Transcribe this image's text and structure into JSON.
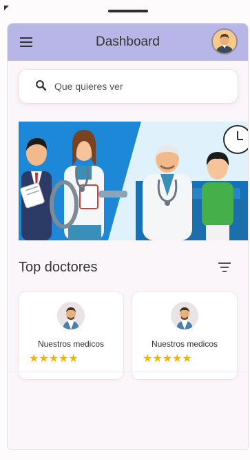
{
  "header": {
    "title": "Dashboard",
    "menu_icon": "menu-icon",
    "avatar_icon": "user-avatar"
  },
  "search": {
    "placeholder": "Que quieres ver",
    "icon": "search-icon"
  },
  "banner": {
    "image": "doctors-illustration"
  },
  "section": {
    "title": "Top doctores",
    "filter_icon": "filter-icon"
  },
  "doctors": [
    {
      "name": "Nuestros medicos",
      "stars": "★★★★★",
      "rating": 5
    },
    {
      "name": "Nuestros medicos",
      "stars": "★★★★★",
      "rating": 5
    }
  ],
  "colors": {
    "appbar": "#b8b6e6",
    "star": "#f4b400",
    "background": "#fbf6f9"
  }
}
